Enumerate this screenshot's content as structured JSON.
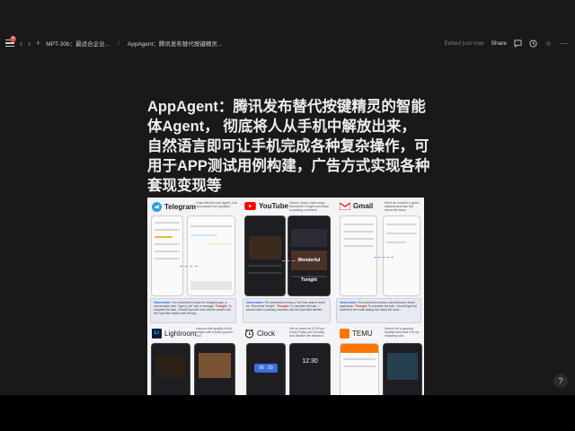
{
  "toolbar": {
    "notification_count": "4",
    "breadcrumbs": [
      "MPT-30b：最适合企业...",
      "AppAgent：腾讯发布替代按键精灵..."
    ],
    "edited_label": "Edited just now",
    "share_label": "Share"
  },
  "page": {
    "title": "AppAgent：腾讯发布替代按键精灵的智能体Agent， 彻底将人从手机中解放出来，自然语言即可让手机完成各种复杂操作，可用于APP测试用例构建，广告方式实现各种套现变现等"
  },
  "figure": {
    "apps": [
      {
        "name": "Telegram",
        "accent": "#2aa3e0",
        "caption": "Chat with the user Agent_Lab and answer the question"
      },
      {
        "name": "YouTube",
        "accent": "#ff0000",
        "caption": "Search music video song Wonderful Tonight and leave a praising comment"
      },
      {
        "name": "Gmail",
        "accent": "#d93025",
        "caption": "Send an email to a given address and ask him about the issue"
      },
      {
        "name": "Lightroom",
        "accent": "#31a8ff",
        "caption": "Improve the quality of this image until it looks good to you"
      },
      {
        "name": "Clock",
        "accent": "#333333",
        "caption": "Set an alarm at 12:30 pm every Friday and Sunday, and disable the vibration"
      },
      {
        "name": "TEMU",
        "accent": "#fb7701",
        "caption": "Search for a gaming headset and add it to my shopping cart"
      }
    ],
    "video_text": "Wonderful Tonight",
    "clock_time": "06 : 00",
    "clock_time_2": "12:30",
    "observations": [
      {
        "label": "Observation:",
        "text": "The screenshot shows the Telegram app, a conversation from \"Agent_Lab\" with a message.",
        "thought_label": "Thought:",
        "thought": "To complete the task, I should input the text with the answer into the input field related with the tag ..."
      },
      {
        "label": "Observation:",
        "text": "The screenshot shows a YouTube search result for \"Wonderful Tonight\".",
        "thought_label": "Thought:",
        "thought": "To complete the task, I should share a praising comment and the input field labeled ..."
      },
      {
        "label": "Observation:",
        "text": "The screenshot shows a smartphone's email application.",
        "thought_label": "Thought:",
        "thought": "To complete the task, I should type the content of the email asking him about the issue ..."
      }
    ]
  },
  "help_label": "?"
}
